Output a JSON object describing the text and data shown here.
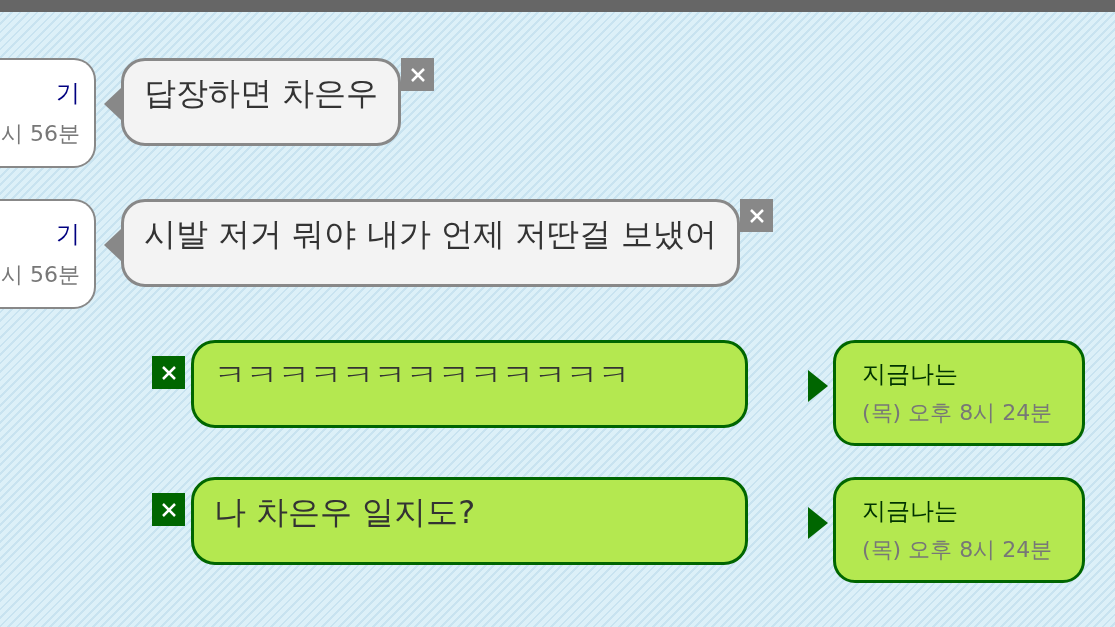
{
  "messages": [
    {
      "kind": "incoming",
      "text": "답장하면 차은우",
      "sender": {
        "name": "기",
        "time": "시 56분"
      }
    },
    {
      "kind": "incoming",
      "text": "시발 저거 뭐야 내가 언제 저딴걸 보냈어",
      "sender": {
        "name": "기",
        "time": "시 56분"
      }
    },
    {
      "kind": "outgoing",
      "text": "ㅋㅋㅋㅋㅋㅋㅋㅋㅋㅋㅋㅋㅋ",
      "sender": {
        "name": "지금나는",
        "time": "(목) 오후 8시 24분"
      }
    },
    {
      "kind": "outgoing",
      "text": "나 차은우 일지도?",
      "sender": {
        "name": "지금나는",
        "time": "(목) 오후 8시 24분"
      }
    }
  ]
}
